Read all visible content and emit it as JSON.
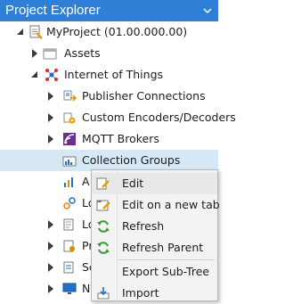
{
  "panel": {
    "title": "Project Explorer"
  },
  "tree": {
    "project": "MyProject (01.00.000.00)",
    "assets": "Assets",
    "iot": "Internet of Things",
    "publisher": "Publisher Connections",
    "encoders": "Custom Encoders/Decoders",
    "mqtt": "MQTT Brokers",
    "collection": "Collection Groups",
    "partial": [
      "A",
      "Lo",
      "Lo",
      "Pr",
      "Sc",
      "N"
    ]
  },
  "context_menu": {
    "items": [
      "Edit",
      "Edit on a new tab",
      "Refresh",
      "Refresh Parent",
      "Export Sub-Tree",
      "Import"
    ]
  }
}
